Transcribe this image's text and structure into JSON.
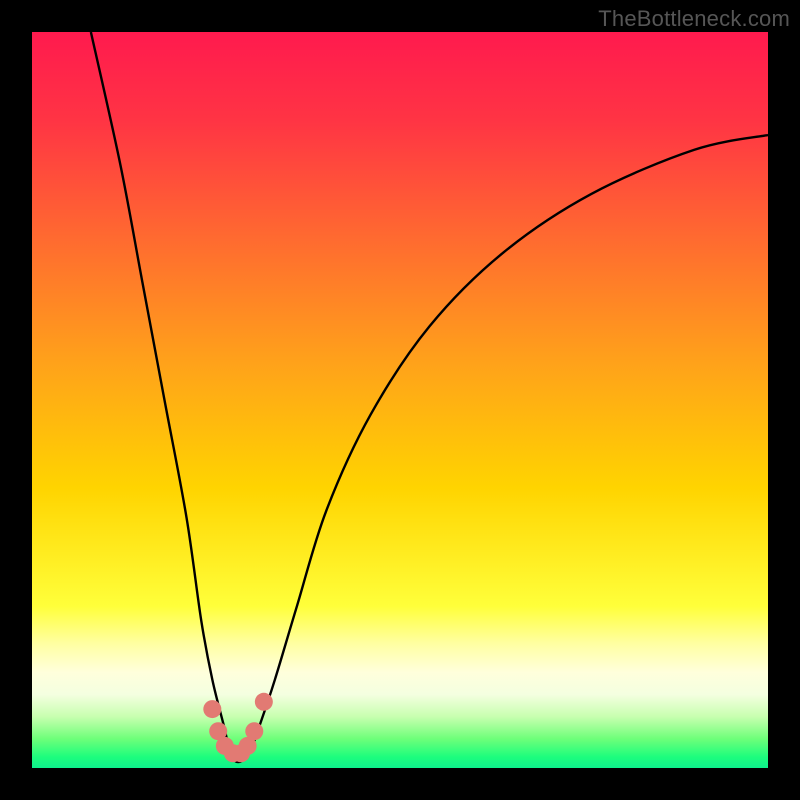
{
  "watermark": "TheBottleneck.com",
  "colors": {
    "black": "#000000",
    "curve": "#000000",
    "marker": "#e27a73",
    "gradient_stops": [
      {
        "offset": 0.0,
        "color": "#ff1a4e"
      },
      {
        "offset": 0.12,
        "color": "#ff3444"
      },
      {
        "offset": 0.28,
        "color": "#ff6a30"
      },
      {
        "offset": 0.45,
        "color": "#ffa21a"
      },
      {
        "offset": 0.62,
        "color": "#ffd400"
      },
      {
        "offset": 0.78,
        "color": "#ffff3a"
      },
      {
        "offset": 0.83,
        "color": "#ffffa0"
      },
      {
        "offset": 0.87,
        "color": "#ffffdc"
      },
      {
        "offset": 0.9,
        "color": "#f4ffe0"
      },
      {
        "offset": 0.93,
        "color": "#c8ffb0"
      },
      {
        "offset": 0.96,
        "color": "#6fff7a"
      },
      {
        "offset": 0.985,
        "color": "#1dfd7d"
      },
      {
        "offset": 1.0,
        "color": "#0ef08c"
      }
    ]
  },
  "chart_data": {
    "type": "line",
    "title": "",
    "xlabel": "",
    "ylabel": "",
    "xlim": [
      0,
      100
    ],
    "ylim": [
      0,
      100
    ],
    "series": [
      {
        "name": "bottleneck-curve",
        "x": [
          8,
          12,
          15,
          18,
          21,
          23,
          24.5,
          26,
          27,
          28,
          29.5,
          31,
          33,
          36,
          40,
          46,
          54,
          64,
          76,
          90,
          100
        ],
        "y": [
          100,
          82,
          66,
          50,
          34,
          20,
          12,
          6,
          2,
          0.8,
          2,
          6,
          12,
          22,
          35,
          48,
          60,
          70,
          78,
          84,
          86
        ]
      }
    ],
    "markers": {
      "name": "highlight-cluster",
      "points": [
        {
          "x": 24.5,
          "y": 8
        },
        {
          "x": 25.3,
          "y": 5
        },
        {
          "x": 26.2,
          "y": 3
        },
        {
          "x": 27.3,
          "y": 2
        },
        {
          "x": 28.4,
          "y": 2
        },
        {
          "x": 29.3,
          "y": 3
        },
        {
          "x": 30.2,
          "y": 5
        },
        {
          "x": 31.5,
          "y": 9
        }
      ]
    }
  }
}
